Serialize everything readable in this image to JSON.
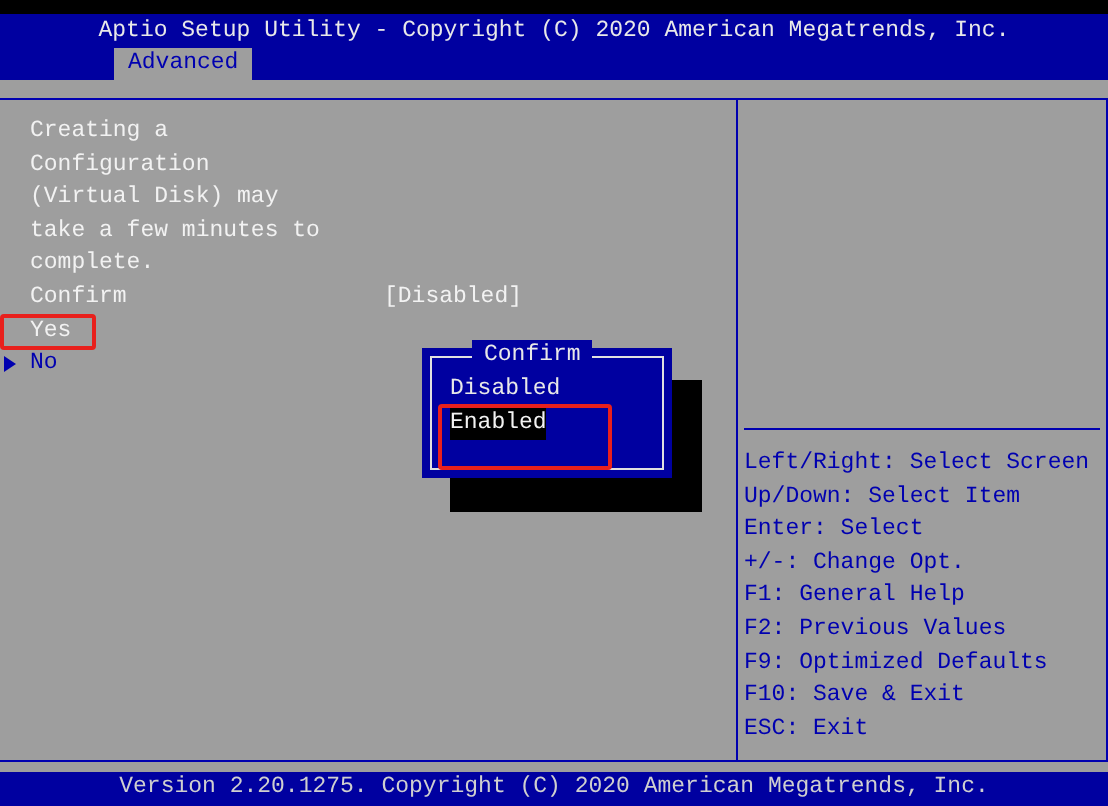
{
  "header": {
    "title": "Aptio Setup Utility - Copyright (C) 2020 American Megatrends, Inc.",
    "tabs": [
      {
        "label": "Advanced",
        "selected": true
      }
    ]
  },
  "description": "Creating a Configuration (Virtual Disk) may take a few minutes to complete.",
  "items": [
    {
      "kind": "setting",
      "label": "Confirm",
      "value": "[Disabled]",
      "annotated": false
    },
    {
      "kind": "action",
      "label": "Yes",
      "annotated": true
    },
    {
      "kind": "submenu",
      "label": "No",
      "annotated": false
    }
  ],
  "popup": {
    "title": "Confirm",
    "options": [
      {
        "label": "Disabled",
        "selected": false,
        "annotated": false
      },
      {
        "label": "Enabled",
        "selected": true,
        "annotated": true
      }
    ]
  },
  "help": [
    "Left/Right: Select Screen",
    "Up/Down: Select Item",
    "Enter: Select",
    "+/-: Change Opt.",
    "F1: General Help",
    "F2: Previous Values",
    "F9: Optimized Defaults",
    "F10: Save & Exit",
    "ESC: Exit"
  ],
  "footer": "Version 2.20.1275. Copyright (C) 2020 American Megatrends, Inc."
}
